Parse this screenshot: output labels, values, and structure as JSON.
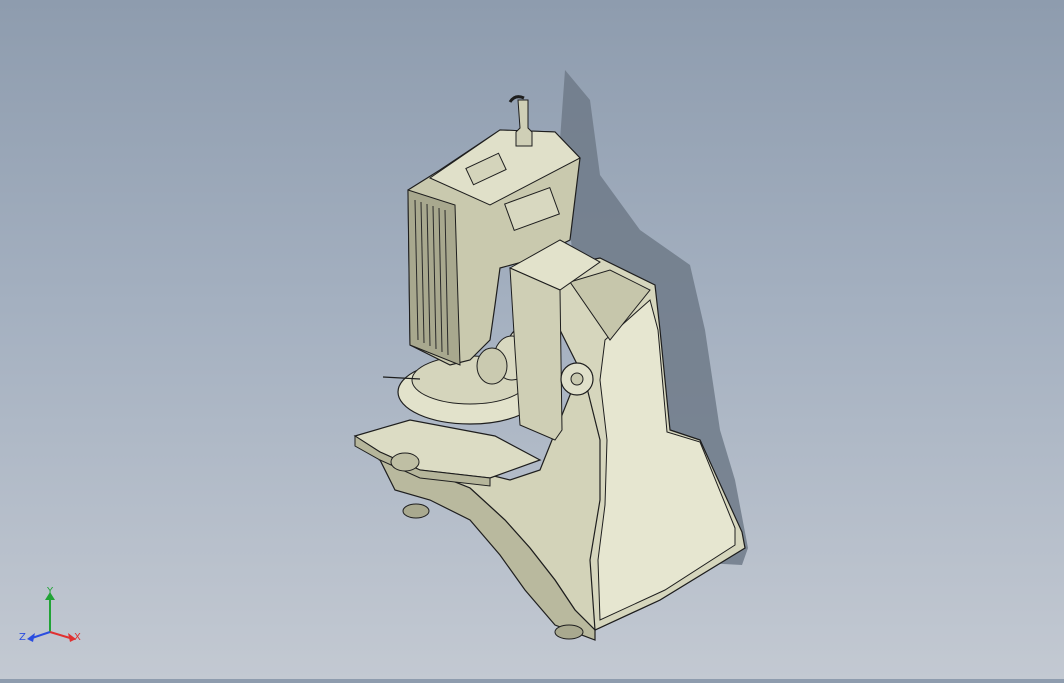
{
  "viewport": {
    "background_top": "#8e9cae",
    "background_bottom": "#c3c9d2",
    "model_color": "#d2d2b8",
    "model_shadow": "#6f7a88",
    "edge_color": "#1e1e1e"
  },
  "triad": {
    "x_label": "X",
    "y_label": "Y",
    "z_label": "Z",
    "x_color": "#e03030",
    "y_color": "#21a336",
    "z_color": "#2a4de0"
  }
}
